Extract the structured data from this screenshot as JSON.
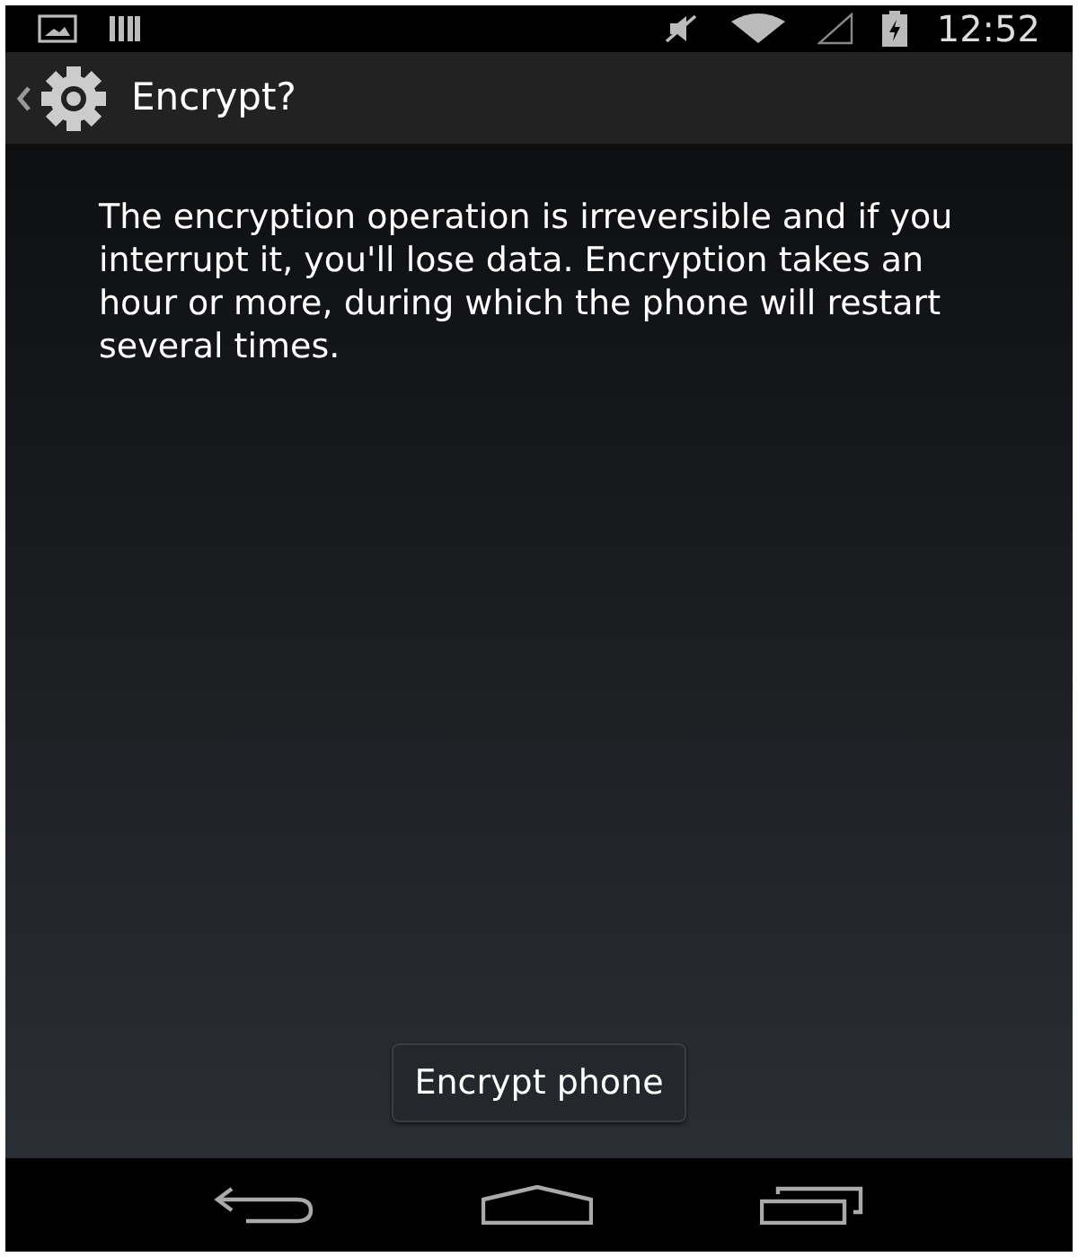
{
  "status_bar": {
    "time": "12:52"
  },
  "action_bar": {
    "title": "Encrypt?"
  },
  "message": "The encryption operation is irreversible and if you interrupt it, you'll lose data. Encryption takes an hour or more, during which the phone will restart several times.",
  "button": {
    "label": "Encrypt phone"
  }
}
